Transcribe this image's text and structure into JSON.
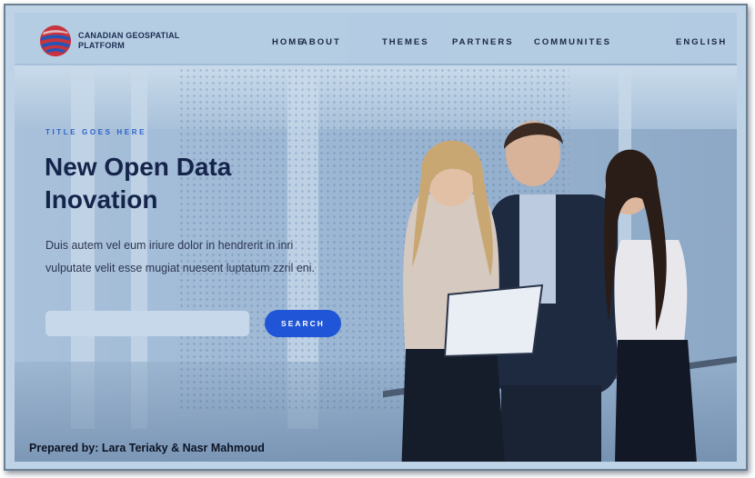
{
  "header": {
    "logo_line1": "CANADIAN GEOSPATIAL",
    "logo_line2": "PLATFORM",
    "nav": [
      "HOME",
      "ABOUT",
      "THEMES",
      "PARTNERS",
      "COMMUNITES"
    ],
    "language": "ENGLISH"
  },
  "hero": {
    "eyebrow": "TITLE GOES HERE",
    "headline_line1": "New Open Data",
    "headline_line2": "Inovation",
    "description": "Duis autem vel eum iriure dolor in hendrerit in inri vulputate velit esse mugiat nuesent luptatum zzril eni.",
    "search_placeholder": "",
    "search_button": "SEARCH"
  },
  "footer_note": "Prepared by: Lara Teriaky & Nasr Mahmoud",
  "colors": {
    "accent": "#1f55d6",
    "headline": "#15244a",
    "eyebrow": "#2c62c9",
    "header_bg": "#b6cee4"
  },
  "icons": {
    "logo": "striped-globe-logo-icon"
  }
}
